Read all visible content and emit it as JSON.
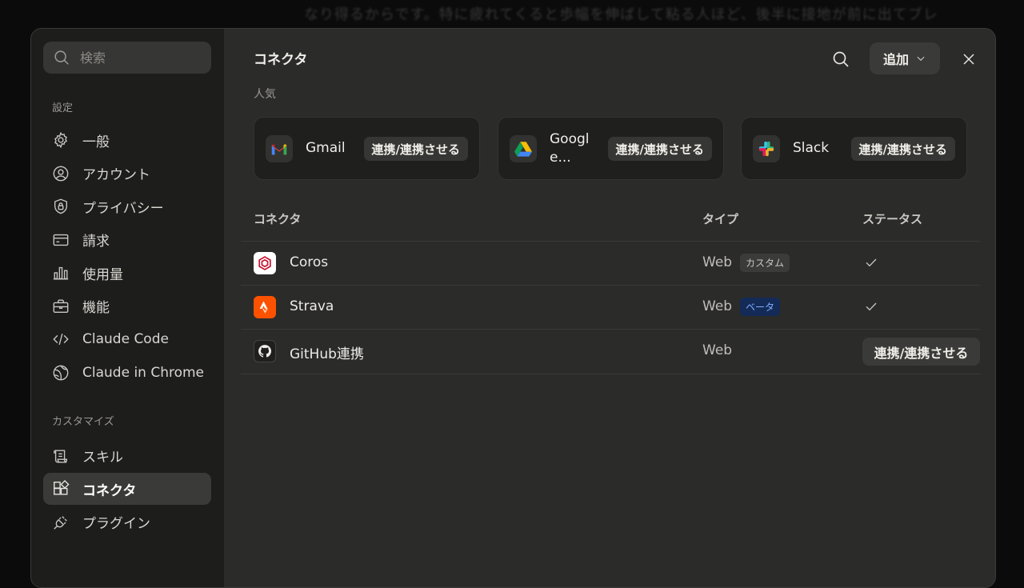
{
  "background_text": "なり得るからです。特に疲れてくると歩幅を伸ばして粘る人ほど、後半に接地が前に出てブレ",
  "sidebar": {
    "search_placeholder": "検索",
    "settings_label": "設定",
    "settings_items": [
      {
        "label": "一般",
        "icon": "gear-icon"
      },
      {
        "label": "アカウント",
        "icon": "user-circle-icon"
      },
      {
        "label": "プライバシー",
        "icon": "shield-lock-icon"
      },
      {
        "label": "請求",
        "icon": "credit-card-icon"
      },
      {
        "label": "使用量",
        "icon": "bar-chart-icon"
      },
      {
        "label": "機能",
        "icon": "briefcase-icon"
      },
      {
        "label": "Claude Code",
        "icon": "code-icon"
      },
      {
        "label": "Claude in Chrome",
        "icon": "globe-icon"
      }
    ],
    "customize_label": "カスタマイズ",
    "customize_items": [
      {
        "label": "スキル",
        "icon": "scroll-icon"
      },
      {
        "label": "コネクタ",
        "icon": "blocks-icon",
        "active": true
      },
      {
        "label": "プラグイン",
        "icon": "plug-icon"
      }
    ]
  },
  "header": {
    "title": "コネクタ",
    "add_label": "追加"
  },
  "popular": {
    "label": "人気",
    "cards": [
      {
        "name": "Gmail",
        "action": "連携/連携させる",
        "icon": "gmail-icon"
      },
      {
        "name": "Googl e...",
        "action": "連携/連携させる",
        "icon": "google-drive-icon"
      },
      {
        "name": "Slack",
        "action": "連携/連携させる",
        "icon": "slack-icon"
      }
    ]
  },
  "table": {
    "headers": {
      "connector": "コネクタ",
      "type": "タイプ",
      "status": "ステータス"
    },
    "rows": [
      {
        "name": "Coros",
        "type": "Web",
        "badge": "カスタム",
        "status": "connected",
        "icon": "coros-icon"
      },
      {
        "name": "Strava",
        "type": "Web",
        "badge": "ベータ",
        "status": "connected",
        "icon": "strava-icon"
      },
      {
        "name": "GitHub連携",
        "type": "Web",
        "badge": "",
        "status": "連携/連携させる",
        "icon": "github-icon"
      }
    ]
  },
  "colors": {
    "background": "#0b0b0b",
    "modal": "#2b2b2a",
    "sidebar": "#1d1d1c",
    "beta_badge": "#142a57",
    "strava_orange": "#fc5200",
    "coros_red": "#c8102e"
  }
}
